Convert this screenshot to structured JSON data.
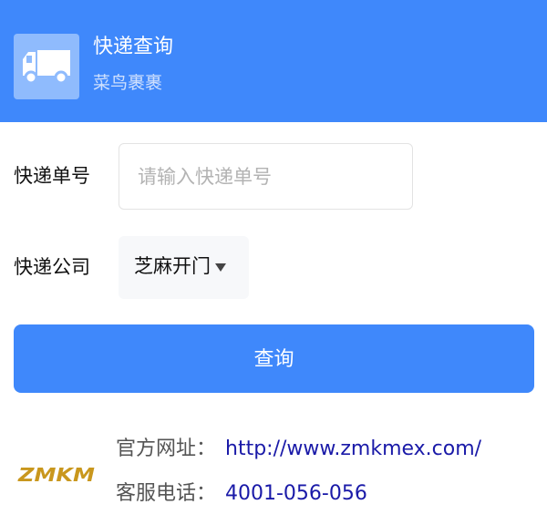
{
  "header": {
    "icon": "truck-icon",
    "title": "快递查询",
    "subtitle": "菜鸟裹裹"
  },
  "form": {
    "tracking_label": "快递单号",
    "tracking_placeholder": "请输入快递单号",
    "tracking_value": "",
    "company_label": "快递公司",
    "company_value": "芝麻开门",
    "submit_label": "查询"
  },
  "info": {
    "logo_text": "ZMKM",
    "website_label": "官方网址：",
    "website_value": "http://www.zmkmex.com/",
    "phone_label": "客服电话：",
    "phone_value": "4001-056-056"
  },
  "colors": {
    "accent": "#3f88fb",
    "link": "#1a1aa8",
    "logo": "#c9971d"
  }
}
